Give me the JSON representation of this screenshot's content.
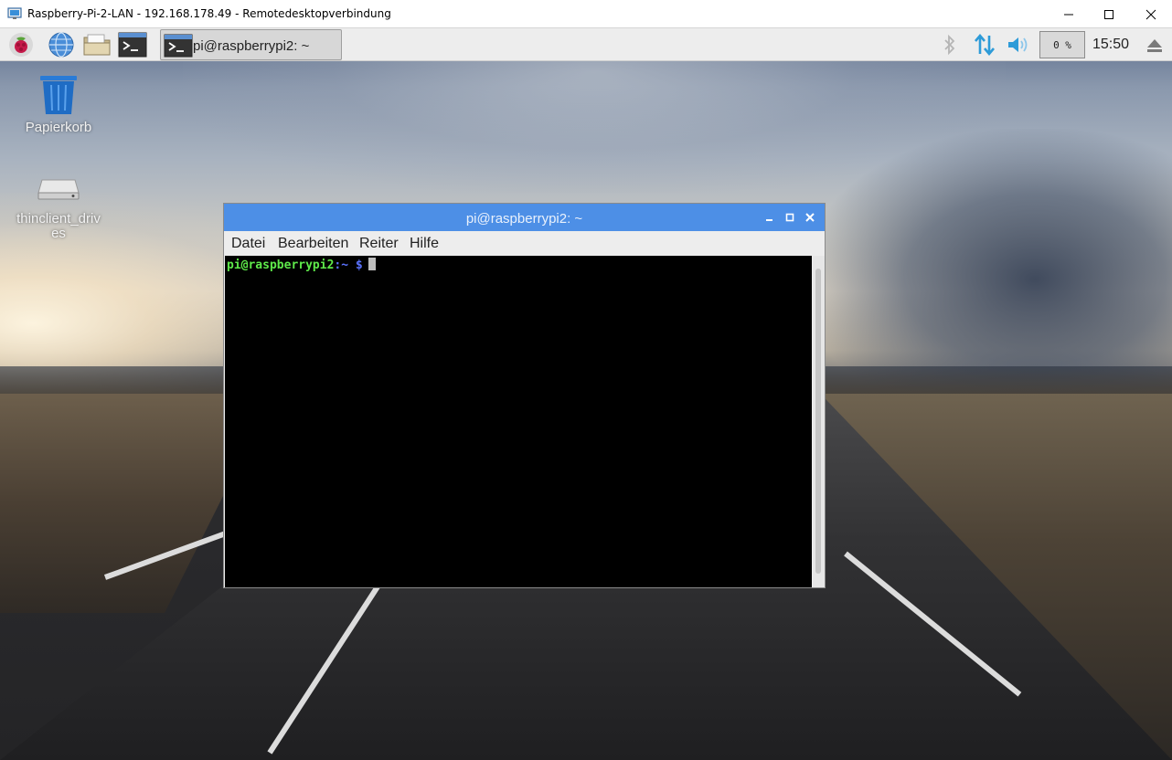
{
  "rdp_window": {
    "title": "Raspberry-Pi-2-LAN - 192.168.178.49 - Remotedesktopverbindung"
  },
  "panel": {
    "launchers": [
      "raspberry-menu-icon",
      "web-browser-icon",
      "file-manager-icon",
      "terminal-icon"
    ],
    "task_button_label": "pi@raspberrypi2: ~",
    "cpu_usage": "0 %",
    "clock": "15:50"
  },
  "desktop_icons": [
    {
      "name": "trash-icon",
      "label": "Papierkorb"
    },
    {
      "name": "drive-icon",
      "label": "thinclient_drives"
    }
  ],
  "terminal": {
    "title": "pi@raspberrypi2: ~",
    "menu": [
      "Datei",
      "Bearbeiten",
      "Reiter",
      "Hilfe"
    ],
    "prompt_user": "pi@raspberrypi2",
    "prompt_path": ":~ $"
  },
  "colors": {
    "terminal_titlebar": "#4d8fe6",
    "prompt_user": "#5ee94a",
    "prompt_path": "#5b73ff",
    "tray_accent": "#2d9bd8"
  }
}
